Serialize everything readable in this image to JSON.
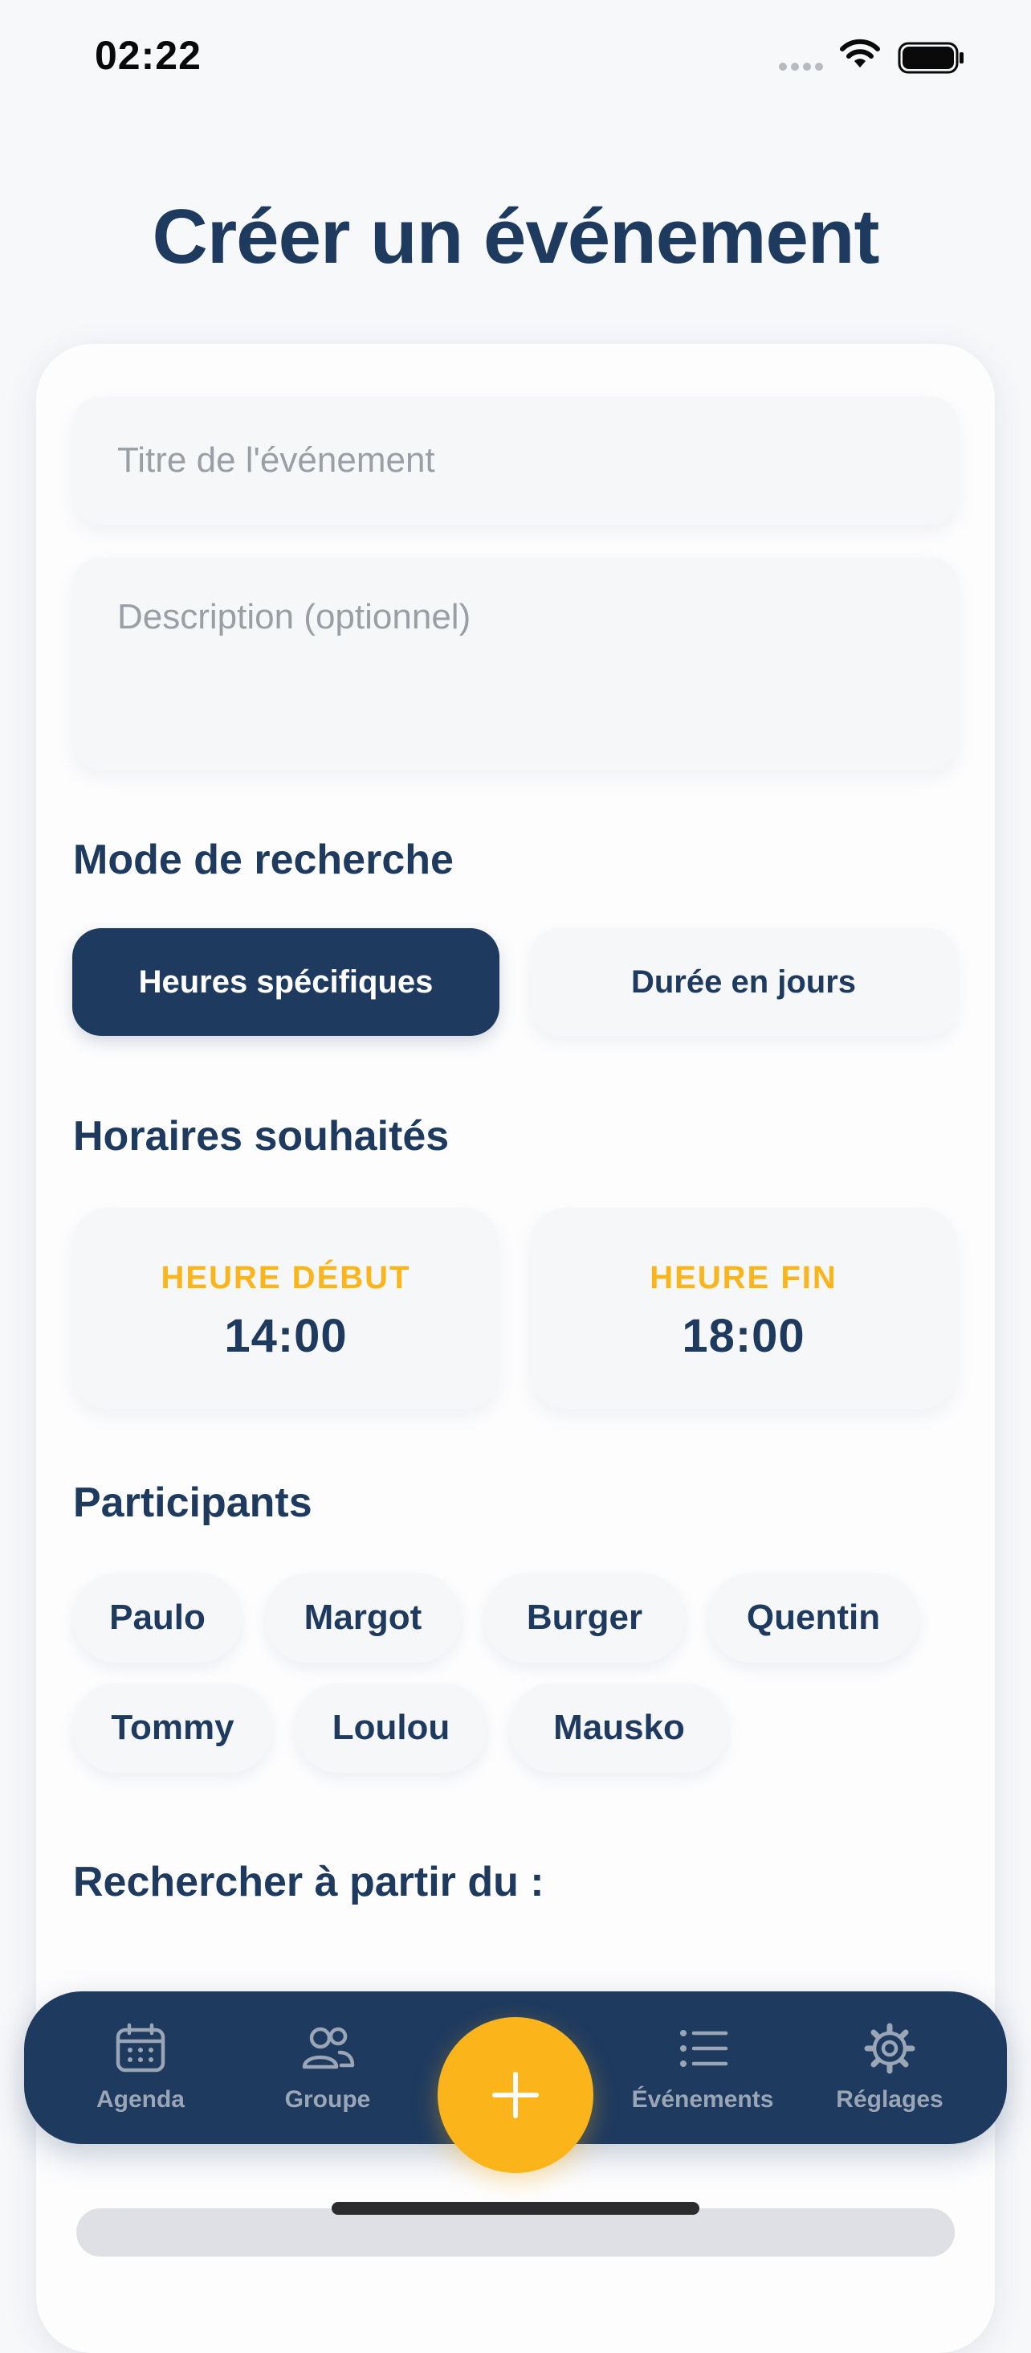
{
  "status_bar": {
    "time": "02:22"
  },
  "header": {
    "title": "Créer un événement"
  },
  "form": {
    "title_placeholder": "Titre de l'événement",
    "description_placeholder": "Description (optionnel)"
  },
  "search_mode": {
    "label": "Mode de recherche",
    "options": [
      "Heures spécifiques",
      "Durée en jours"
    ],
    "selected": "Heures spécifiques"
  },
  "schedule": {
    "label": "Horaires souhaités",
    "start_label": "HEURE DÉBUT",
    "start_value": "14:00",
    "end_label": "HEURE FIN",
    "end_value": "18:00"
  },
  "participants": {
    "label": "Participants",
    "names": [
      "Paulo",
      "Margot",
      "Burger",
      "Quentin",
      "Tommy",
      "Loulou",
      "Mausko"
    ]
  },
  "search_from": {
    "label": "Rechercher à partir du :"
  },
  "nav": {
    "items": [
      {
        "label": "Agenda",
        "icon": "calendar-icon"
      },
      {
        "label": "Groupe",
        "icon": "group-icon"
      },
      {
        "label": "Événements",
        "icon": "list-icon"
      },
      {
        "label": "Réglages",
        "icon": "gear-icon"
      }
    ],
    "fab_icon": "plus-icon"
  },
  "colors": {
    "primary": "#1e3a5f",
    "accent": "#fbb41a",
    "background": "#f7f8fa",
    "muted": "#9aa6b6"
  }
}
